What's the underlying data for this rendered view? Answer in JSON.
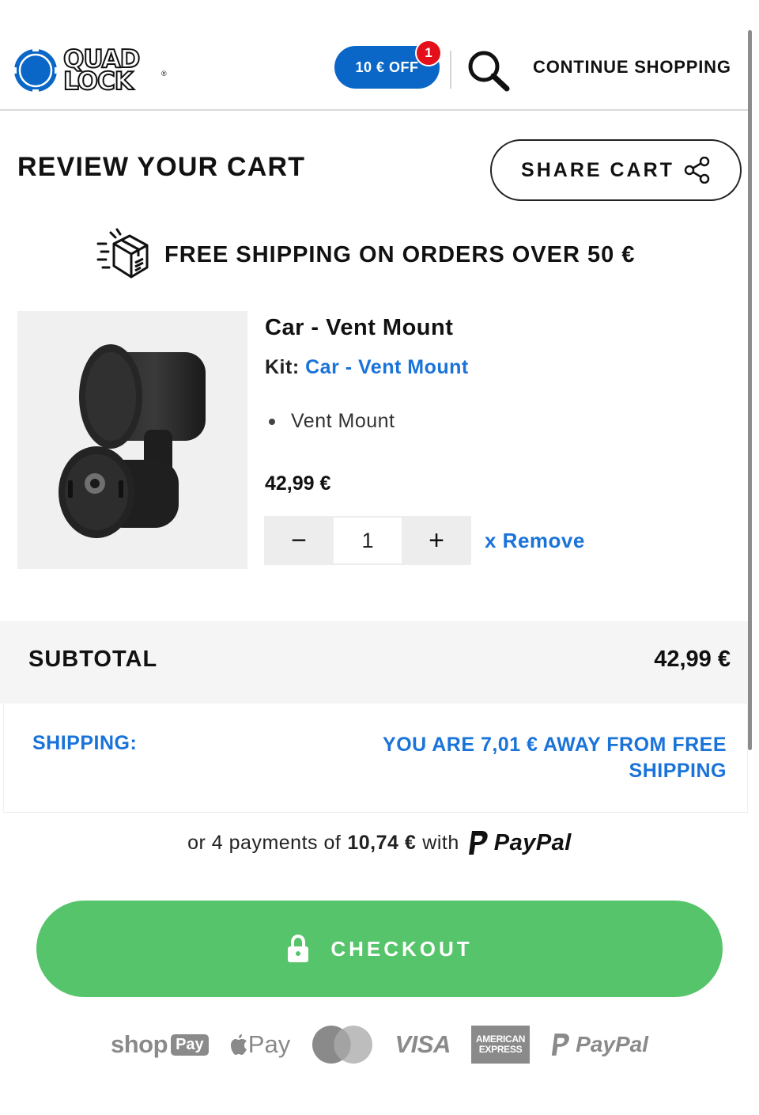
{
  "header": {
    "logo_line1": "QUAD",
    "logo_line2": "LOCK",
    "logo_reg": "®",
    "promo_label": "10 € OFF",
    "promo_count": "1",
    "continue_label": "CONTINUE SHOPPING"
  },
  "cart": {
    "title": "REVIEW YOUR CART",
    "share_label": "SHARE CART",
    "shipping_banner": "FREE SHIPPING ON ORDERS OVER 50 €"
  },
  "item": {
    "name": "Car - Vent Mount",
    "kit_prefix": "Kit:",
    "kit_name": "Car - Vent Mount",
    "kit_items": [
      "Vent Mount"
    ],
    "price": "42,99 €",
    "quantity": "1",
    "decrement": "−",
    "increment": "+",
    "remove_label": "x Remove"
  },
  "totals": {
    "subtotal_label": "SUBTOTAL",
    "subtotal_value": "42,99 €",
    "shipping_label": "SHIPPING:",
    "shipping_message": "YOU ARE 7,01 € AWAY FROM FREE SHIPPING"
  },
  "installments": {
    "prefix": "or 4 payments of",
    "amount": "10,74 €",
    "suffix": "with",
    "provider": "PayPal"
  },
  "checkout": {
    "label": "CHECKOUT"
  },
  "payment_methods": {
    "shop": "shop",
    "shop_pay": "Pay",
    "apple_pay": "Pay",
    "visa": "VISA",
    "amex_line1": "AMERICAN",
    "amex_line2": "EXPRESS",
    "paypal": "PayPal"
  },
  "colors": {
    "brand_blue": "#0a67c8",
    "link_blue": "#1a73d9",
    "checkout_green": "#56c46a",
    "badge_red": "#e3101b"
  }
}
